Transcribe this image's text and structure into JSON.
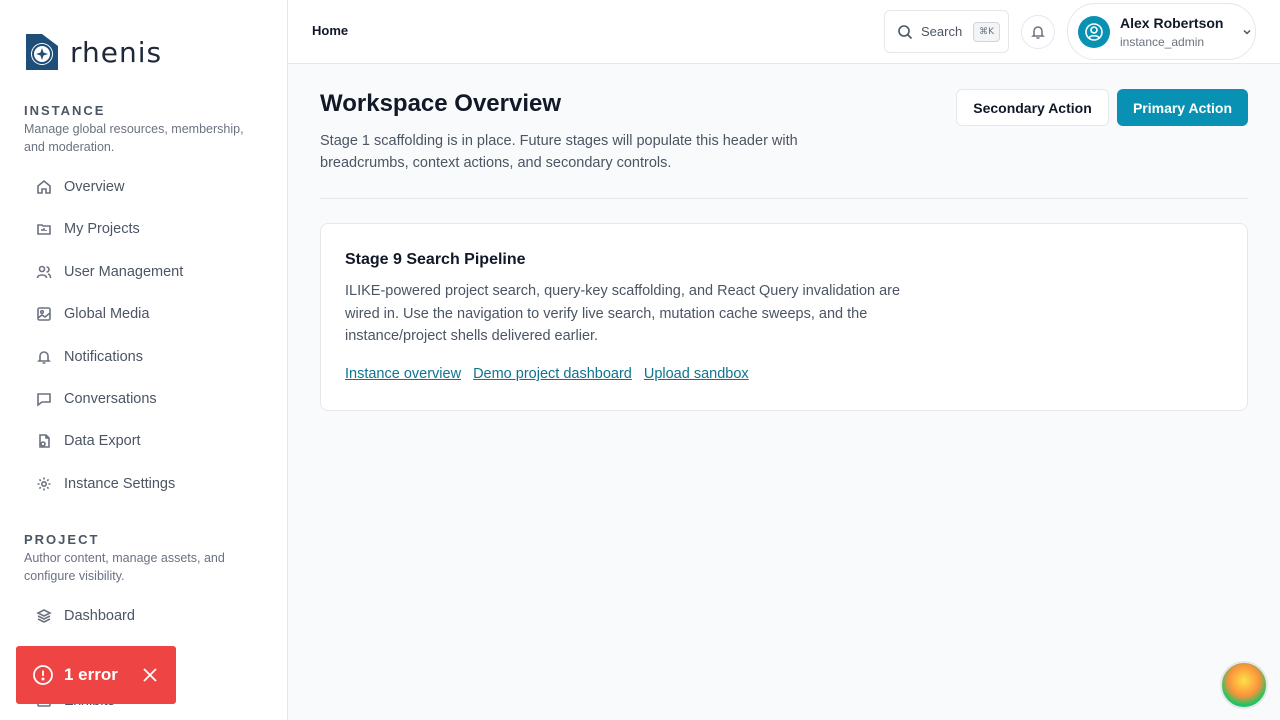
{
  "app": {
    "logo_text": "rhenis"
  },
  "sidebar": {
    "instance": {
      "title": "INSTANCE",
      "description": "Manage global resources, membership, and moderation.",
      "items": [
        {
          "label": "Overview",
          "icon": "home-icon"
        },
        {
          "label": "My Projects",
          "icon": "folder-icon"
        },
        {
          "label": "User Management",
          "icon": "users-icon"
        },
        {
          "label": "Global Media",
          "icon": "image-icon"
        },
        {
          "label": "Notifications",
          "icon": "bell-icon"
        },
        {
          "label": "Conversations",
          "icon": "message-icon"
        },
        {
          "label": "Data Export",
          "icon": "file-export-icon"
        },
        {
          "label": "Instance Settings",
          "icon": "gear-icon"
        }
      ]
    },
    "project": {
      "title": "PROJECT",
      "description": "Author content, manage assets, and configure visibility.",
      "items": [
        {
          "label": "Dashboard",
          "icon": "layers-icon"
        },
        {
          "label": "Exhibits",
          "icon": "exhibits-icon"
        }
      ]
    }
  },
  "topbar": {
    "breadcrumb": "Home",
    "search_label": "Search",
    "search_shortcut": "⌘K",
    "user_name": "Alex Robertson",
    "user_role": "instance_admin"
  },
  "header": {
    "title": "Workspace Overview",
    "description": "Stage 1 scaffolding is in place. Future stages will populate this header with breadcrumbs, context actions, and secondary controls.",
    "secondary_action": "Secondary Action",
    "primary_action": "Primary Action"
  },
  "card": {
    "title": "Stage 9 Search Pipeline",
    "description": "ILIKE-powered project search, query-key scaffolding, and React Query invalidation are wired in. Use the navigation to verify live search, mutation cache sweeps, and the instance/project shells delivered earlier.",
    "links": [
      "Instance overview",
      "Demo project dashboard",
      "Upload sandbox"
    ]
  },
  "toast": {
    "text": "1 error"
  },
  "colors": {
    "accent": "#0891b2",
    "error": "#ef4444",
    "link": "#0e7490"
  }
}
